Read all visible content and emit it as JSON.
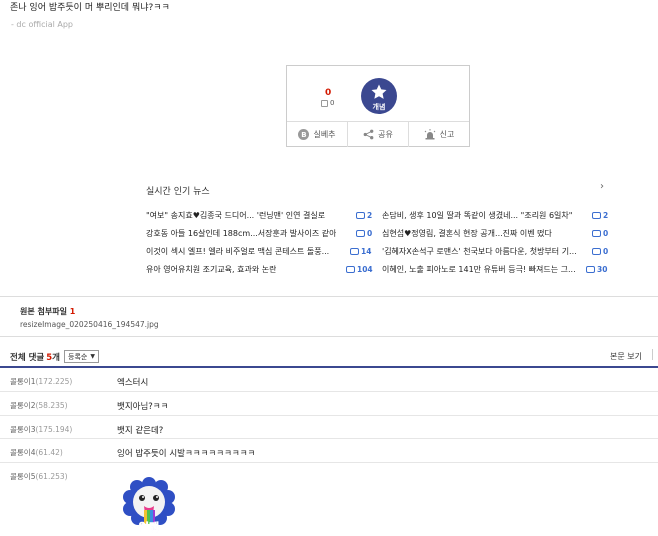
{
  "post": {
    "text": "존나 잉어 밥주듯이 머 뿌리인데 뭐냐?ㅋㅋ",
    "signature": "- dc official App"
  },
  "vote": {
    "up_count": "0",
    "fixed_count": "0",
    "recommend_label": "개념",
    "buttons": [
      {
        "label": "실베추",
        "icon": "b-circle-icon"
      },
      {
        "label": "공유",
        "icon": "share-icon"
      },
      {
        "label": "신고",
        "icon": "siren-icon"
      }
    ]
  },
  "news": {
    "title": "실시간 인기 뉴스",
    "items": [
      {
        "text": "\"여보\" 송지효♥김종국 드디어... '런닝맨' 인연 결실로",
        "count": "2"
      },
      {
        "text": "손담비, 생후 10일 딸과 똑같이 생겼네... \"조리원 6일차\"",
        "count": "2"
      },
      {
        "text": "강호동 아들 16살인데 188cm...서장훈과 발사이즈 같아",
        "count": "0"
      },
      {
        "text": "심현섭♥정영림, 결혼식 현장 공개...진짜 이벤 떴다",
        "count": "0"
      },
      {
        "text": "이것이 섹시 엘프! 엘라 비주얼로 맥심 콘테스트 돌풍...",
        "count": "14"
      },
      {
        "text": "'김혜자X손석구 로맨스' 천국보다 아름다운, 첫방부터 기...",
        "count": "0"
      },
      {
        "text": "유아 영어유치원 조기교육, 효과와 논란",
        "count": "104"
      },
      {
        "text": "이혜인, 노출 피아노로 141만 유튜버 등극! 빠져드는 그...",
        "count": "30"
      }
    ]
  },
  "attachment": {
    "label": "원본 첨부파일",
    "count": "1",
    "filename": "resizeImage_020250416_194547.jpg"
  },
  "comments": {
    "label": "전체 댓글",
    "count": "5",
    "unit": "개",
    "sort": "등록순",
    "view_body": "본문 보기",
    "items": [
      {
        "nick": "콜롱이1",
        "ip": "(172.225)",
        "text": "엑스터시"
      },
      {
        "nick": "콜롱이2",
        "ip": "(58.235)",
        "text": "뱃지아님?ㅋㅋ"
      },
      {
        "nick": "콜롱이3",
        "ip": "(175.194)",
        "text": "뱃지 같은데?"
      },
      {
        "nick": "콜롱이4",
        "ip": "(61.42)",
        "text": "잉어 밥주듯이 시발ㅋㅋㅋㅋㅋㅋㅋㅋㅋ"
      },
      {
        "nick": "콜롱이5",
        "ip": "(61.253)",
        "text": ""
      }
    ],
    "emoji_text": "얼탱"
  }
}
